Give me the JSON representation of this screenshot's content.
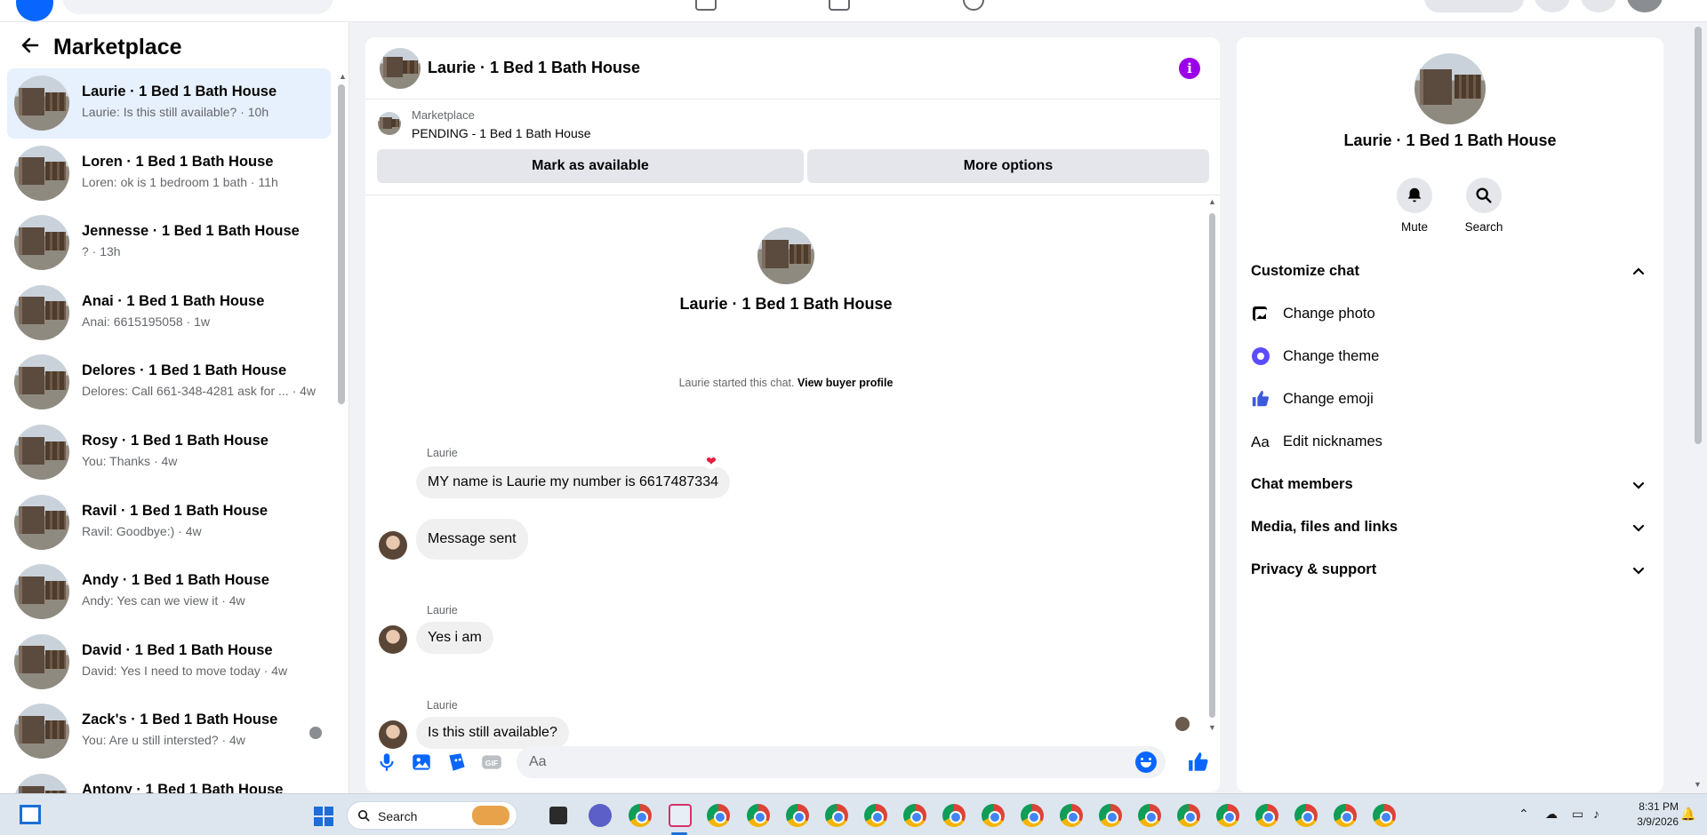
{
  "left": {
    "title": "Marketplace",
    "conversations": [
      {
        "name": "Laurie · 1 Bed 1 Bath House",
        "preview": "Laurie: Is this still available? · 10h",
        "active": true
      },
      {
        "name": "Loren · 1 Bed 1 Bath House",
        "preview": "Loren: ok is 1 bedroom 1 bath · 11h"
      },
      {
        "name": "Jennesse · 1 Bed 1 Bath House",
        "preview": "? · 13h"
      },
      {
        "name": "Anai · 1 Bed 1 Bath House",
        "preview": "Anai: 6615195058 · 1w"
      },
      {
        "name": "Delores · 1 Bed 1 Bath House",
        "preview": "Delores: Call 661-348-4281 ask for ... · 4w"
      },
      {
        "name": "Rosy · 1 Bed 1 Bath House",
        "preview": "You: Thanks · 4w"
      },
      {
        "name": "Ravil · 1 Bed 1 Bath House",
        "preview": "Ravil: Goodbye:) · 4w"
      },
      {
        "name": "Andy · 1 Bed 1 Bath House",
        "preview": "Andy: Yes can we view it · 4w"
      },
      {
        "name": "David · 1 Bed 1 Bath House",
        "preview": "David: Yes I need to move today · 4w"
      },
      {
        "name": "Zack's · 1 Bed 1 Bath House",
        "preview": "You: Are u still intersted? · 4w"
      },
      {
        "name": "Antony · 1 Bed 1 Bath House",
        "preview": ""
      }
    ]
  },
  "chat": {
    "title": "Laurie · 1 Bed 1 Bath House",
    "marketplace_label": "Marketplace",
    "listing_status": "PENDING - 1 Bed 1 Bath House",
    "mark_available": "Mark as available",
    "more_options": "More options",
    "intro_name": "Laurie · 1 Bed 1 Bath House",
    "started_text": "Laurie started this chat.",
    "view_profile": "View buyer profile",
    "messages": [
      {
        "sender": "Laurie",
        "text": "MY name is Laurie my number is 6617487334",
        "reaction": "❤"
      },
      {
        "sender": "",
        "text": "Message sent"
      },
      {
        "sender": "Laurie",
        "text": "Yes i am"
      },
      {
        "sender": "Laurie",
        "text": "Is this still available?"
      }
    ],
    "composer_placeholder": "Aa"
  },
  "right": {
    "name": "Laurie · 1 Bed 1 Bath House",
    "mute": "Mute",
    "search": "Search",
    "customize": "Customize chat",
    "change_photo": "Change photo",
    "change_theme": "Change theme",
    "change_emoji": "Change emoji",
    "nickname_icon_text": "Aa",
    "edit_nicknames": "Edit nicknames",
    "chat_members": "Chat members",
    "media": "Media, files and links",
    "privacy": "Privacy & support"
  },
  "taskbar": {
    "search": "Search",
    "time": "8:31 PM",
    "date": "3/9/2026"
  },
  "colors": {
    "accent": "#0866ff",
    "info": "#9b00e8",
    "active_row": "#e7f0fd"
  }
}
